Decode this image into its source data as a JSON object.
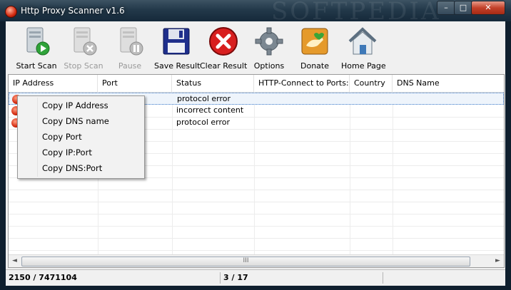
{
  "window": {
    "title": "Http Proxy Scanner v1.6",
    "min": "–",
    "max": "□",
    "close": "✕"
  },
  "toolbar": [
    {
      "label": "Start Scan",
      "icon": "start-scan-icon",
      "enabled": true
    },
    {
      "label": "Stop Scan",
      "icon": "stop-scan-icon",
      "enabled": false
    },
    {
      "label": "Pause",
      "icon": "pause-icon",
      "enabled": false
    },
    {
      "label": "Save Result",
      "icon": "floppy-disk-icon",
      "enabled": true
    },
    {
      "label": "Clear Result",
      "icon": "clear-icon",
      "enabled": true
    },
    {
      "label": "Options",
      "icon": "gear-icon",
      "enabled": true
    },
    {
      "label": "Donate",
      "icon": "donate-hand-icon",
      "enabled": true
    },
    {
      "label": "Home Page",
      "icon": "home-icon",
      "enabled": true
    }
  ],
  "table": {
    "columns": [
      "IP Address",
      "Port",
      "Status",
      "HTTP-Connect to Ports:",
      "Country",
      "DNS Name"
    ],
    "rows": [
      {
        "ip": "",
        "port": "",
        "status": "protocol error",
        "http": "",
        "country": "",
        "dns": ""
      },
      {
        "ip": "",
        "port": "",
        "status": "incorrect content",
        "http": "",
        "country": "",
        "dns": ""
      },
      {
        "ip": "",
        "port": "",
        "status": "protocol error",
        "http": "",
        "country": "",
        "dns": ""
      }
    ]
  },
  "context_menu": [
    "Copy IP Address",
    "Copy DNS name",
    "Copy Port",
    "Copy IP:Port",
    "Copy DNS:Port"
  ],
  "scrollbar": {
    "left": "◄",
    "right": "►",
    "grip": "III"
  },
  "status": {
    "progress": "2150 / 7471104",
    "count": "3 / 17"
  },
  "colors": {
    "title_bg": "#23394a",
    "close_button": "#c3412a",
    "selection_border": "#3a78c8",
    "error_icon": "#d32a10"
  }
}
